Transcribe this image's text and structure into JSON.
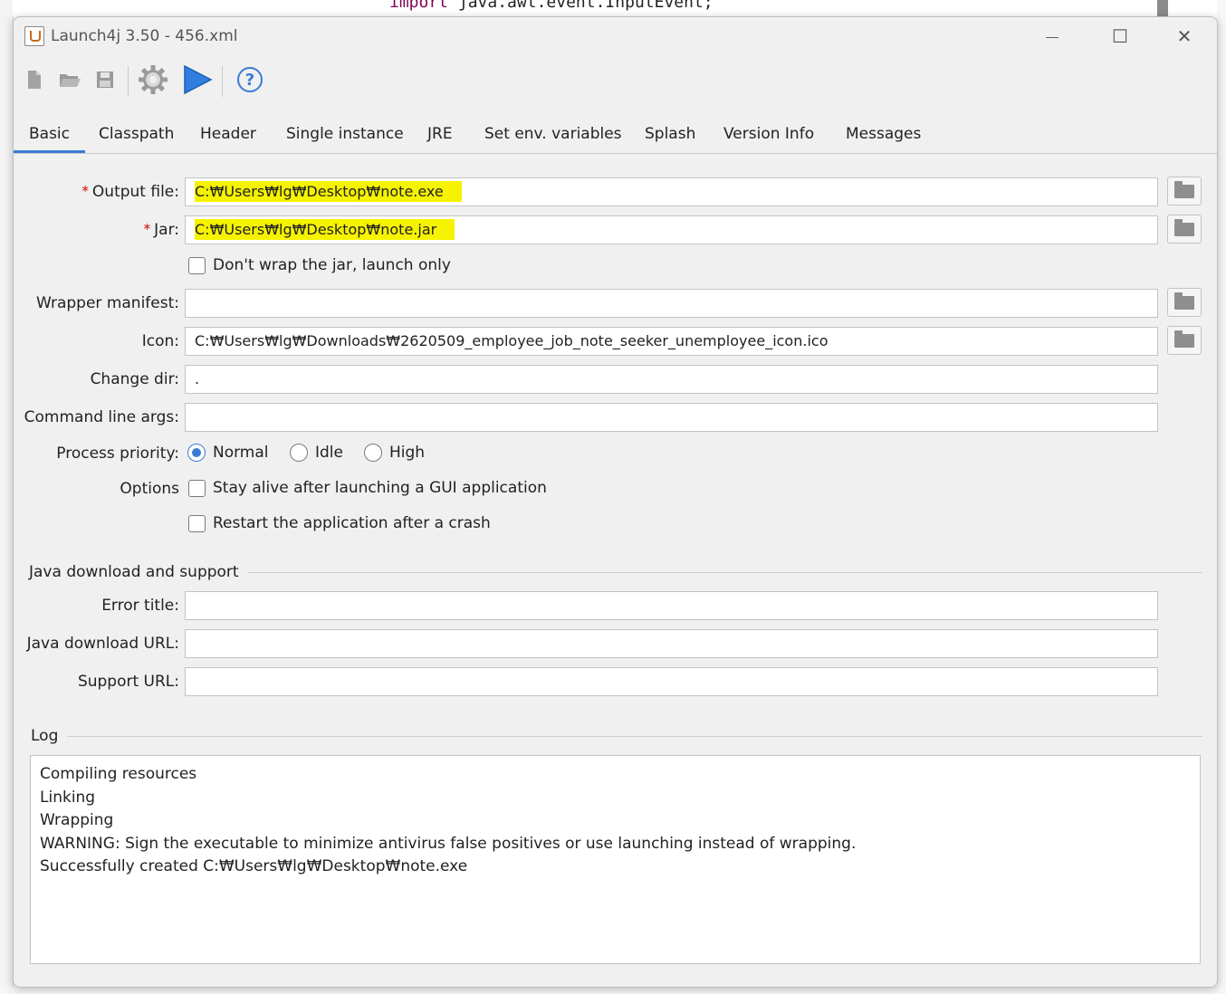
{
  "background": {
    "code_keyword": "import",
    "code_rest": "java.awt.event.InputEvent;"
  },
  "window": {
    "title": "Launch4j 3.50 - 456.xml",
    "controls": {
      "minimize": "—",
      "maximize": "☐",
      "close": "✕"
    }
  },
  "toolbar": {
    "icons": [
      "new-file-icon",
      "open-folder-icon",
      "save-icon",
      "build-gear-icon",
      "run-play-icon",
      "help-icon"
    ],
    "help_glyph": "?"
  },
  "tabs": [
    {
      "label": "Basic",
      "active": true
    },
    {
      "label": "Classpath"
    },
    {
      "label": "Header"
    },
    {
      "label": "Single instance"
    },
    {
      "label": "JRE"
    },
    {
      "label": "Set env. variables"
    },
    {
      "label": "Splash"
    },
    {
      "label": "Version Info"
    },
    {
      "label": "Messages"
    }
  ],
  "form": {
    "required_mark": "*",
    "output_file": {
      "label": "Output file:",
      "value": "C:₩Users₩lg₩Desktop₩note.exe"
    },
    "jar": {
      "label": "Jar:",
      "value": "C:₩Users₩lg₩Desktop₩note.jar"
    },
    "dont_wrap": {
      "label": "Don't wrap the jar, launch only",
      "checked": false
    },
    "wrapper_manifest": {
      "label": "Wrapper manifest:",
      "value": ""
    },
    "icon": {
      "label": "Icon:",
      "value": "C:₩Users₩lg₩Downloads₩2620509_employee_job_note_seeker_unemployee_icon.ico"
    },
    "change_dir": {
      "label": "Change dir:",
      "value": "."
    },
    "command_line_args": {
      "label": "Command line args:",
      "value": ""
    },
    "process_priority": {
      "label": "Process priority:",
      "options": [
        "Normal",
        "Idle",
        "High"
      ],
      "selected": "Normal"
    },
    "options_label": "Options",
    "stay_alive": {
      "label": "Stay alive after launching a GUI application",
      "checked": false
    },
    "restart": {
      "label": "Restart the application after a crash",
      "checked": false
    }
  },
  "java_download": {
    "section_title": "Java download and support",
    "error_title": {
      "label": "Error title:",
      "value": ""
    },
    "download_url": {
      "label": "Java download URL:",
      "value": ""
    },
    "support_url": {
      "label": "Support URL:",
      "value": ""
    }
  },
  "log": {
    "section_title": "Log",
    "lines": [
      "Compiling resources",
      "Linking",
      "Wrapping",
      "WARNING: Sign the executable to minimize antivirus false positives or use launching instead of wrapping.",
      "Successfully created C:₩Users₩lg₩Desktop₩note.exe"
    ]
  },
  "colors": {
    "accent": "#3b7bd6",
    "highlight": "#f6f300",
    "required": "#d00000",
    "window_bg": "#f0f0f0"
  }
}
